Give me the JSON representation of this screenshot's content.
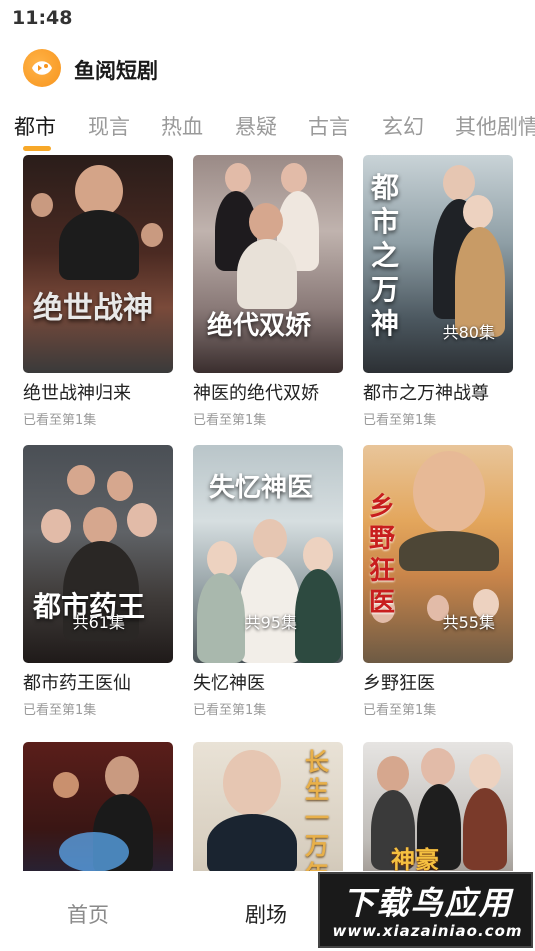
{
  "status_bar": {
    "time": "11:48"
  },
  "app": {
    "title": "鱼阅短剧",
    "logo_icon": "fish-logo-icon",
    "accent": "#f7a829"
  },
  "tabs": [
    {
      "label": "都市",
      "active": true
    },
    {
      "label": "现言",
      "active": false
    },
    {
      "label": "热血",
      "active": false
    },
    {
      "label": "悬疑",
      "active": false
    },
    {
      "label": "古言",
      "active": false
    },
    {
      "label": "玄幻",
      "active": false
    },
    {
      "label": "其他剧情",
      "active": false
    }
  ],
  "dramas": [
    {
      "title": "绝世战神归来",
      "progress": "已看至第1集",
      "episodes": "",
      "poster_text": "绝世战神"
    },
    {
      "title": "神医的绝代双娇",
      "progress": "已看至第1集",
      "episodes": "",
      "poster_text": "绝代双娇"
    },
    {
      "title": "都市之万神战尊",
      "progress": "已看至第1集",
      "episodes": "共80集",
      "poster_text": "都市之万神"
    },
    {
      "title": "都市药王医仙",
      "progress": "已看至第1集",
      "episodes": "共61集",
      "poster_text": "都市药王"
    },
    {
      "title": "失忆神医",
      "progress": "已看至第1集",
      "episodes": "共95集",
      "poster_text": "失忆神医"
    },
    {
      "title": "乡野狂医",
      "progress": "已看至第1集",
      "episodes": "共55集",
      "poster_text": "乡野狂医"
    },
    {
      "title": "",
      "progress": "",
      "episodes": "",
      "poster_text": ""
    },
    {
      "title": "",
      "progress": "",
      "episodes": "",
      "poster_text": "长生一万年"
    },
    {
      "title": "",
      "progress": "",
      "episodes": "",
      "poster_text": "神豪"
    }
  ],
  "bottom_nav": [
    {
      "label": "首页",
      "active": false
    },
    {
      "label": "剧场",
      "active": true
    }
  ],
  "watermark": {
    "main": "下载鸟应用",
    "url": "www.xiazainiao.com"
  }
}
